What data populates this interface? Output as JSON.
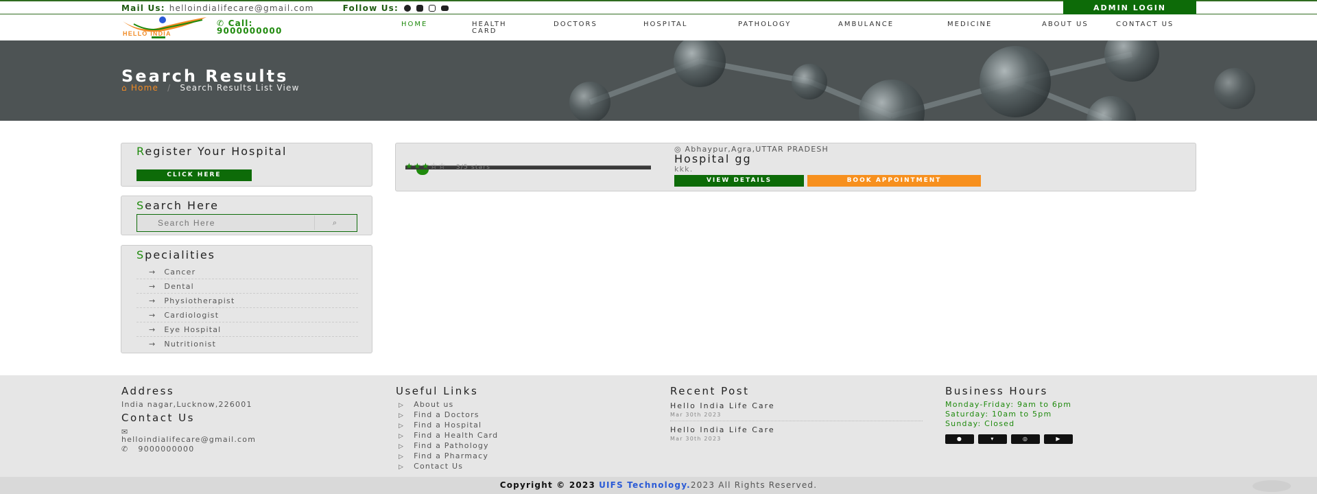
{
  "topbar": {
    "mail_label": "Mail Us:",
    "mail_value": "helloindialifecare@gmail.com",
    "follow_label": "Follow Us:",
    "admin_login": "ADMIN LOGIN"
  },
  "header": {
    "logo_text": "HELLO INDIA",
    "call_label": "Call:",
    "call_number": "9000000000",
    "nav": [
      {
        "label": "HOME"
      },
      {
        "label": "HEALTH CARD"
      },
      {
        "label": "DOCTORS"
      },
      {
        "label": "HOSPITAL"
      },
      {
        "label": "PATHOLOGY"
      },
      {
        "label": "AMBULANCE"
      },
      {
        "label": "MEDICINE"
      },
      {
        "label": "ABOUT US"
      },
      {
        "label": "CONTACT US"
      }
    ]
  },
  "hero": {
    "title": "Search Results",
    "crumb_home": "Home",
    "crumb_sep": "/",
    "crumb_current": "Search Results List View"
  },
  "sidebar": {
    "register": {
      "first": "R",
      "rest": "egister Your Hospital",
      "button": "CLICK HERE"
    },
    "search": {
      "first": "S",
      "rest": "earch Here",
      "placeholder": "Search Here"
    },
    "specialities": {
      "first": "S",
      "rest": "pecialities",
      "items": [
        "Cancer",
        "Dental",
        "Physiotherapist",
        "Cardiologist",
        "Eye Hospital",
        "Nutritionist"
      ]
    }
  },
  "result": {
    "stars_filled": 3,
    "stars_total": 5,
    "stars_label": "3/5 stars",
    "location": "Abhaypur,Agra,UTTAR PRADESH",
    "name": "Hospital gg",
    "description": "kkk.",
    "view_details": "VIEW DETAILS",
    "book_appointment": "BOOK APPOINTMENT"
  },
  "footer": {
    "address_title": "Address",
    "address": "India nagar,Lucknow,226001",
    "contact_title": "Contact Us",
    "email": "helloindialifecare@gmail.com",
    "phone": "9000000000",
    "links_title": "Useful Links",
    "links": [
      "About us",
      "Find a Doctors",
      "Find a Hospital",
      "Find a Health Card",
      "Find a Pathology",
      "Find a Pharmacy",
      "Contact Us"
    ],
    "recent_title": "Recent Post",
    "posts": [
      {
        "title": "Hello India Life Care",
        "date": "Mar 30th 2023"
      },
      {
        "title": "Hello India Life Care",
        "date": "Mar 30th 2023"
      }
    ],
    "hours_title": "Business Hours",
    "hours": [
      "Monday-Friday: 9am to 6pm",
      "Saturday: 10am to 5pm",
      "Sunday: Closed"
    ]
  },
  "copyright": {
    "prefix": "Copyright © 2023",
    "company": "UIFS Technology.",
    "suffix": "2023 All Rights Reserved."
  },
  "colors": {
    "brand_green": "#0d6b08",
    "accent_orange": "#f7901e",
    "link_blue": "#2a5ad6"
  }
}
